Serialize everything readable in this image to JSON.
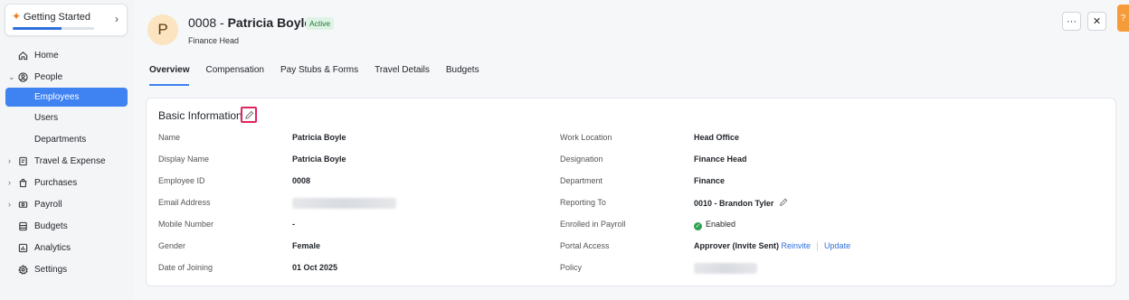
{
  "getting_started": {
    "title": "Getting Started",
    "progress_fraction": 0.6
  },
  "sidebar": {
    "items": [
      {
        "label": "Home"
      },
      {
        "label": "People"
      },
      {
        "label": "Employees"
      },
      {
        "label": "Users"
      },
      {
        "label": "Departments"
      },
      {
        "label": "Travel & Expense"
      },
      {
        "label": "Purchases"
      },
      {
        "label": "Payroll"
      },
      {
        "label": "Budgets"
      },
      {
        "label": "Analytics"
      },
      {
        "label": "Settings"
      }
    ]
  },
  "employee": {
    "avatar_letter": "P",
    "id": "0008 - ",
    "name": "Patricia Boyle",
    "status": "Active",
    "role": "Finance Head"
  },
  "header_buttons": {
    "more": "···",
    "close": "✕",
    "help": "?"
  },
  "tabs": [
    {
      "label": "Overview"
    },
    {
      "label": "Compensation"
    },
    {
      "label": "Pay Stubs & Forms"
    },
    {
      "label": "Travel Details"
    },
    {
      "label": "Budgets"
    }
  ],
  "basic_info": {
    "title": "Basic Information",
    "left": [
      {
        "label": "Name",
        "value": "Patricia Boyle"
      },
      {
        "label": "Display Name",
        "value": "Patricia Boyle"
      },
      {
        "label": "Employee ID",
        "value": "0008"
      },
      {
        "label": "Email Address",
        "value": ""
      },
      {
        "label": "Mobile Number",
        "value": "-"
      },
      {
        "label": "Gender",
        "value": "Female"
      },
      {
        "label": "Date of Joining",
        "value": "01 Oct 2025"
      }
    ],
    "right": [
      {
        "label": "Work Location",
        "value": "Head Office"
      },
      {
        "label": "Designation",
        "value": "Finance Head"
      },
      {
        "label": "Department",
        "value": "Finance"
      },
      {
        "label": "Reporting To",
        "value": "0010 - Brandon Tyler"
      },
      {
        "label": "Enrolled in Payroll",
        "value": "Enabled"
      },
      {
        "label": "Portal Access",
        "value": "Approver (Invite Sent)",
        "reinvite": "Reinvite",
        "update": "Update"
      },
      {
        "label": "Policy",
        "value": ""
      }
    ]
  },
  "colors": {
    "accent": "#3f82f1",
    "highlight_box": "#e0245e",
    "enabled_green": "#2ea24f",
    "avatar_bg": "#fbe4bf"
  }
}
